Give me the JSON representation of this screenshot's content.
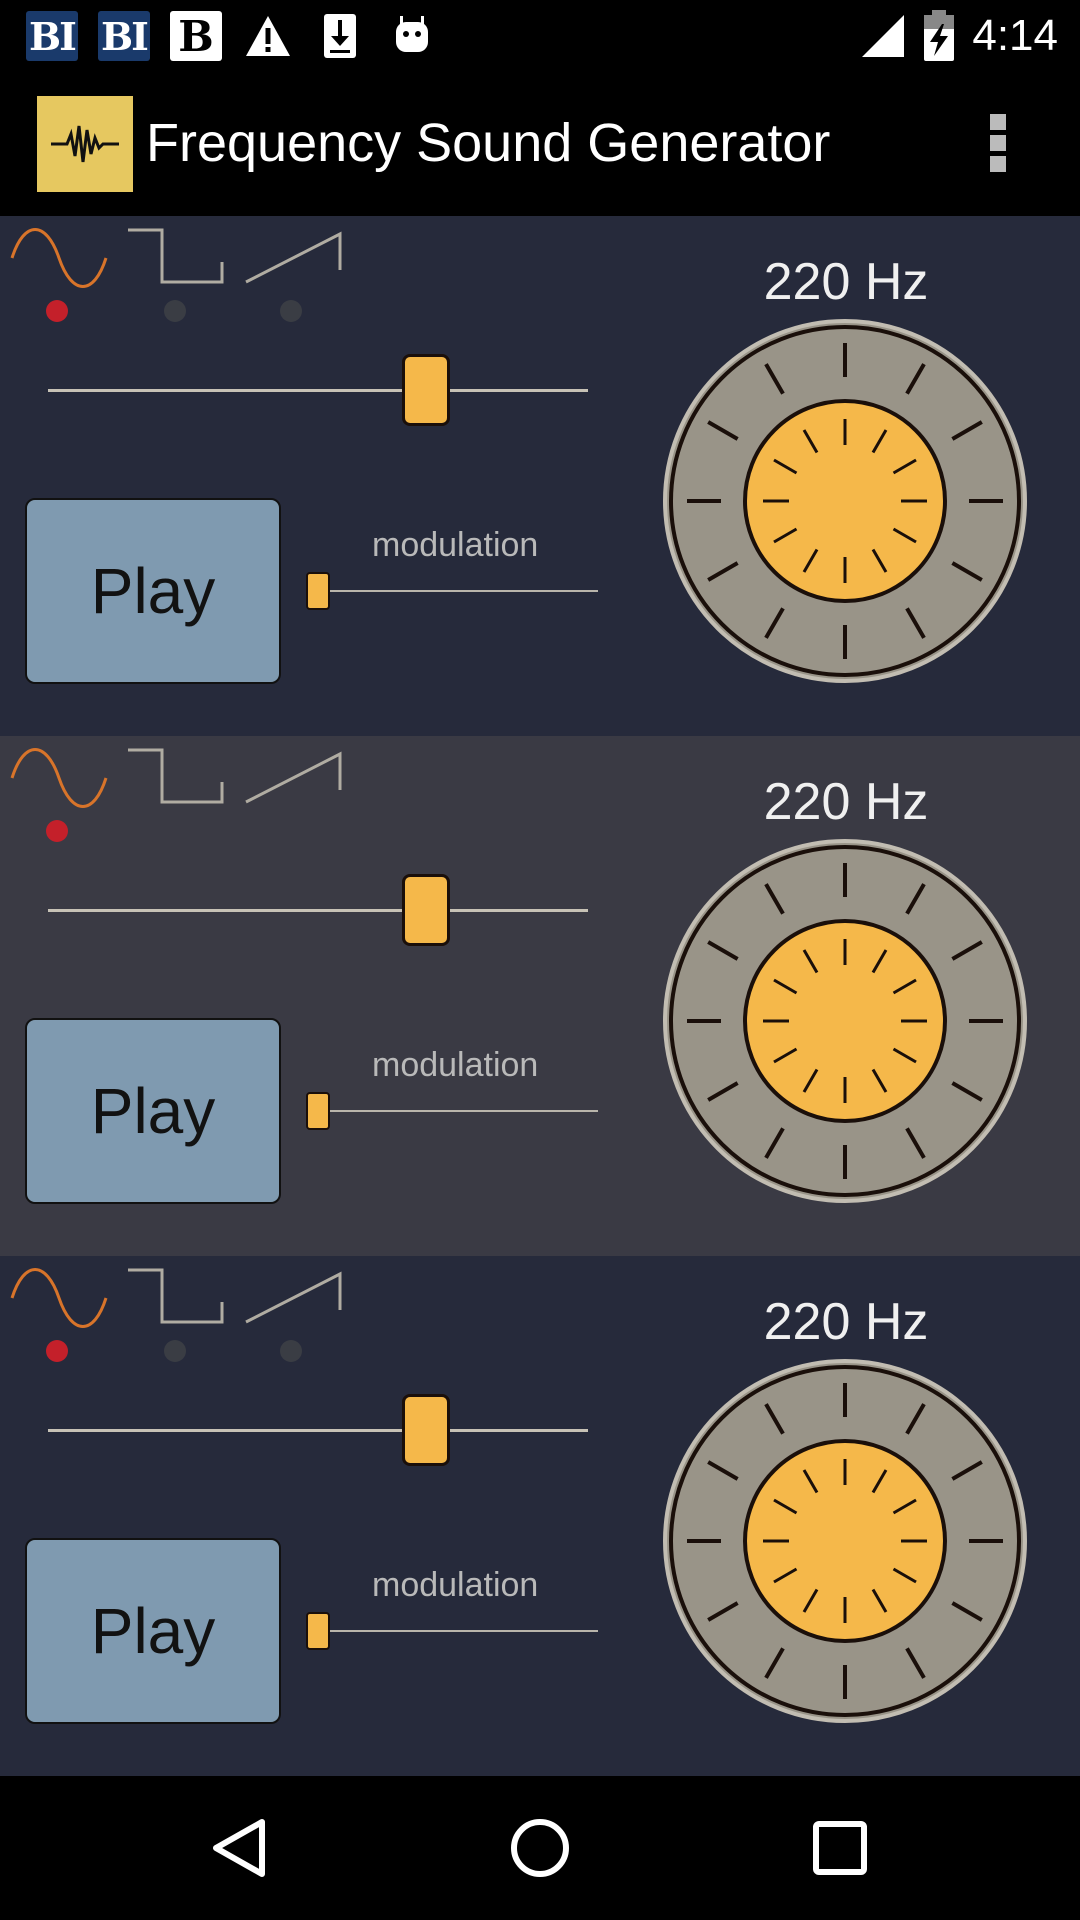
{
  "status_bar": {
    "time": "4:14",
    "notifications": [
      {
        "icon": "bi-app-icon",
        "text": "BI"
      },
      {
        "icon": "bi-app-icon",
        "text": "BI"
      },
      {
        "icon": "b-app-icon",
        "text": "B"
      },
      {
        "icon": "warning-icon"
      },
      {
        "icon": "download-icon"
      },
      {
        "icon": "android-icon"
      }
    ],
    "signal_icon": "signal-icon",
    "battery_icon": "battery-charging-icon"
  },
  "app_bar": {
    "title": "Frequency Sound Generator",
    "icon": "waveform-icon",
    "menu_icon": "overflow-menu-icon"
  },
  "generators": [
    {
      "frequency_label": "220 Hz",
      "play_label": "Play",
      "modulation_label": "modulation",
      "waveforms": [
        "sine",
        "square",
        "sawtooth"
      ],
      "selected_waveform": "sine",
      "frequency_slider_fraction": 0.7,
      "modulation_slider_fraction": 0.0
    },
    {
      "frequency_label": "220 Hz",
      "play_label": "Play",
      "modulation_label": "modulation",
      "waveforms": [
        "sine",
        "square",
        "sawtooth"
      ],
      "selected_waveform": "sine",
      "frequency_slider_fraction": 0.7,
      "modulation_slider_fraction": 0.0
    },
    {
      "frequency_label": "220 Hz",
      "play_label": "Play",
      "modulation_label": "modulation",
      "waveforms": [
        "sine",
        "square",
        "sawtooth"
      ],
      "selected_waveform": "sine",
      "frequency_slider_fraction": 0.7,
      "modulation_slider_fraction": 0.0
    }
  ],
  "nav_bar": {
    "back_icon": "back-triangle-icon",
    "home_icon": "home-circle-icon",
    "recents_icon": "recents-square-icon"
  },
  "colors": {
    "panel_dark": "#262a3b",
    "panel_mid": "#3a3a44",
    "accent_orange": "#f5b84a",
    "sine_orange": "#d8742a",
    "selected_red": "#c4202a",
    "play_blue": "#7f9ab0",
    "knob_grey": "#999488"
  }
}
